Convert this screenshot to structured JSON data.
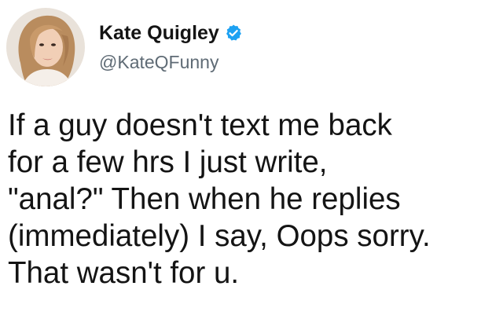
{
  "tweet": {
    "author": {
      "display_name": "Kate Quigley",
      "handle": "@KateQFunny",
      "verified": true,
      "avatar_icon": "profile-photo",
      "verified_icon": "verified-badge-icon",
      "verified_color": "#1da1f2"
    },
    "text_lines": [
      "If a guy doesn't text me back",
      "for a few hrs I just write,",
      "\"anal?\" Then when he replies",
      "(immediately) I say, Oops sorry.",
      "That wasn't for u."
    ]
  },
  "colors": {
    "background": "#ffffff",
    "text": "#141414",
    "handle": "#5f6b75",
    "accent": "#1da1f2"
  }
}
